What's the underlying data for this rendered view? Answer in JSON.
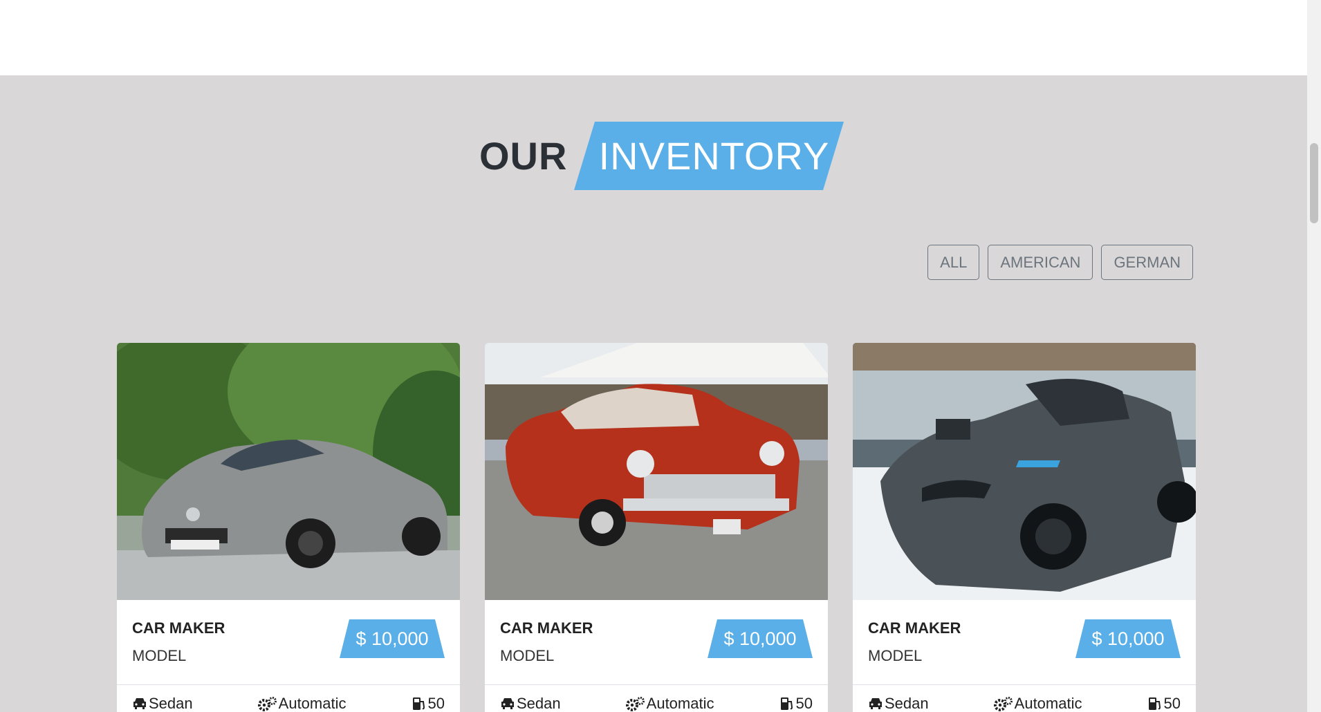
{
  "heading": {
    "word1": "OUR",
    "word2": "INVENTORY"
  },
  "filters": [
    "ALL",
    "AMERICAN",
    "GERMAN"
  ],
  "colors": {
    "accent": "#5aafe8",
    "section_bg": "#d9d7d8",
    "heading_dark": "#2b2f36"
  },
  "cars": [
    {
      "maker": "CAR MAKER",
      "model": "MODEL",
      "price": "$ 10,000",
      "body": "Sedan",
      "transmission": "Automatic",
      "fuel": "50",
      "image": "silver-sports-coupe"
    },
    {
      "maker": "CAR MAKER",
      "model": "MODEL",
      "price": "$ 10,000",
      "body": "Sedan",
      "transmission": "Automatic",
      "fuel": "50",
      "image": "red-classic-car"
    },
    {
      "maker": "CAR MAKER",
      "model": "MODEL",
      "price": "$ 10,000",
      "body": "Sedan",
      "transmission": "Automatic",
      "fuel": "50",
      "image": "grey-sports-car"
    }
  ],
  "icons": {
    "body": "car-icon",
    "transmission": "gears-icon",
    "fuel": "gas-pump-icon"
  }
}
